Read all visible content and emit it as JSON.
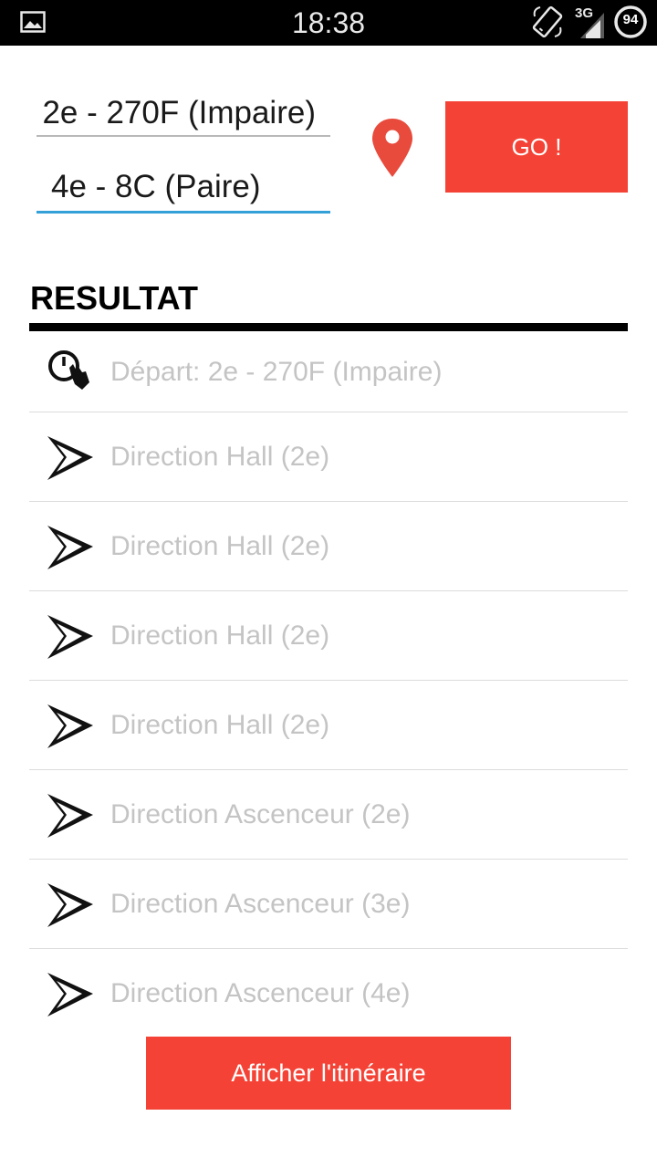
{
  "status_bar": {
    "time": "18:38",
    "network": "3G",
    "battery": "94"
  },
  "form": {
    "from_value": "2e - 270F (Impaire)",
    "to_value": "4e - 8C (Paire)",
    "go_label": "GO !"
  },
  "result": {
    "title": "RESULTAT",
    "departure": "Départ: 2e - 270F (Impaire)",
    "steps": [
      "Direction Hall (2e)",
      "Direction Hall (2e)",
      "Direction Hall (2e)",
      "Direction Hall (2e)",
      "Direction Ascenceur (2e)",
      "Direction Ascenceur (3e)",
      "Direction Ascenceur (4e)"
    ]
  },
  "actions": {
    "show_route_label": "Afficher l'itinéraire"
  },
  "colors": {
    "accent": "#f44336",
    "input_focus": "#33a0d8",
    "step_text": "#c4c4c4"
  }
}
